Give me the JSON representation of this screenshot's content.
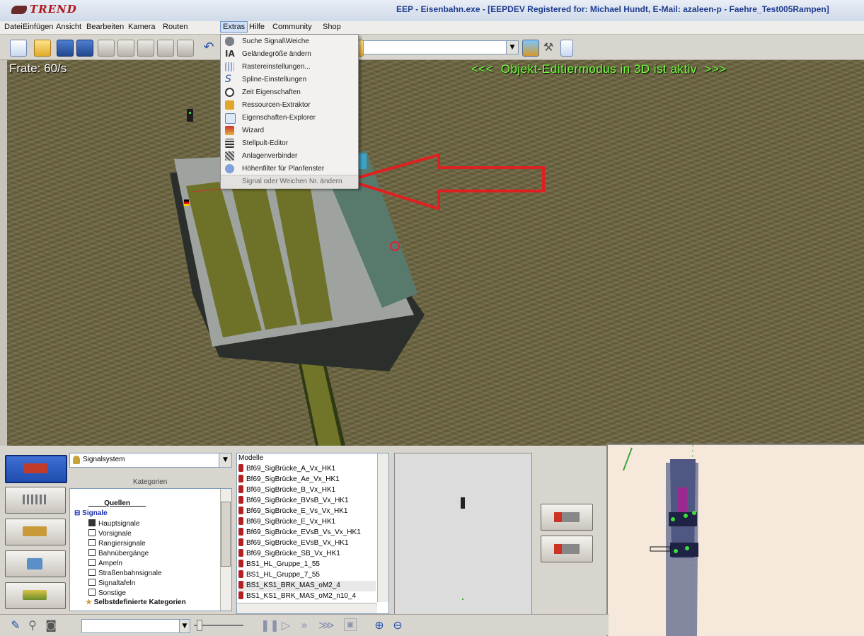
{
  "window": {
    "title": "EEP - Eisenbahn.exe - [EEPDEV Registered for: Michael Hundt, E-Mail: azaleen-p - Faehre_Test005Rampen]",
    "logo_text": "TREND"
  },
  "menubar": {
    "items": [
      "Datei",
      "Einfügen",
      "Ansicht",
      "Bearbeiten",
      "Kamera",
      "Routen",
      "Extras",
      "Hilfe",
      "Community",
      "Shop"
    ],
    "active": "Extras"
  },
  "view3d": {
    "frame_rate": "Frate: 60/s",
    "mode_banner": "<<<  Objekt-Editiermodus in 3D ist aktiv  >>>"
  },
  "extras_menu": {
    "items": [
      {
        "label": "Suche Signal\\Weiche",
        "icon": "search-signal-icon"
      },
      {
        "label": "Geländegröße ändern",
        "icon": "terrain-size-icon"
      },
      {
        "label": "Rastereinstellungen...",
        "icon": "grid-icon"
      },
      {
        "label": "Spline-Einstellungen",
        "icon": "spline-icon"
      },
      {
        "label": "Zeit Eigenschaften",
        "icon": "clock-icon"
      },
      {
        "label": "Ressourcen-Extraktor",
        "icon": "box-icon"
      },
      {
        "label": "Eigenschaften-Explorer",
        "icon": "document-icon"
      },
      {
        "label": "Wizard",
        "icon": "wizard-icon"
      },
      {
        "label": "Stellpult-Editor",
        "icon": "control-panel-icon"
      },
      {
        "label": "Anlagenverbinder",
        "icon": "connector-icon"
      },
      {
        "label": "Höhenfilter für Planfenster",
        "icon": "height-filter-icon"
      },
      {
        "label": "Signal oder Weichen Nr. ändern",
        "icon": "",
        "highlighted": true
      }
    ]
  },
  "bottom_panel": {
    "system_combo": "Signalsystem",
    "categories_label": "Kategorien",
    "tree": [
      {
        "label": "____Quellen____",
        "level": 1,
        "bold": true
      },
      {
        "label": "Signale",
        "level": 0,
        "bold": true,
        "blue": true
      },
      {
        "label": "Hauptsignale",
        "level": 2,
        "checked": true
      },
      {
        "label": "Vorsignale",
        "level": 2
      },
      {
        "label": "Rangiersignale",
        "level": 2
      },
      {
        "label": "Bahnübergänge",
        "level": 2
      },
      {
        "label": "Ampeln",
        "level": 2
      },
      {
        "label": "Straßenbahnsignale",
        "level": 2
      },
      {
        "label": "Signaltafeln",
        "level": 2
      },
      {
        "label": "Sonstige",
        "level": 2
      },
      {
        "label": "Selbstdefinierte Kategorien",
        "level": 1,
        "bold": true
      }
    ],
    "models_header": "Modelle",
    "models": [
      "Bf69_SigBrücke_A_Vx_HK1",
      "Bf69_SigBrücke_Ae_Vx_HK1",
      "Bf69_SigBrücke_B_Vx_HK1",
      "Bf69_SigBrücke_BVsB_Vx_HK1",
      "Bf69_SigBrücke_E_Vs_Vx_HK1",
      "Bf69_SigBrücke_E_Vx_HK1",
      "Bf69_SigBrücke_EVsB_Vs_Vx_HK1",
      "Bf69_SigBrücke_EVsB_Vx_HK1",
      "Bf69_SigBrücke_SB_Vx_HK1",
      "BS1_HL_Gruppe_1_55",
      "BS1_HL_Gruppe_7_55",
      "BS1_KS1_BRK_MAS_oM2_4",
      "BS1_KS1_BRK_MAS_oM2_n10_4"
    ],
    "selected_model": "BS1_KS1_BRK_MAS_oM2_4"
  },
  "colors": {
    "water": "#6e6641",
    "banner_green": "#6cff3a",
    "title_blue": "#1f3d8f",
    "arrow_red": "#e02020"
  }
}
